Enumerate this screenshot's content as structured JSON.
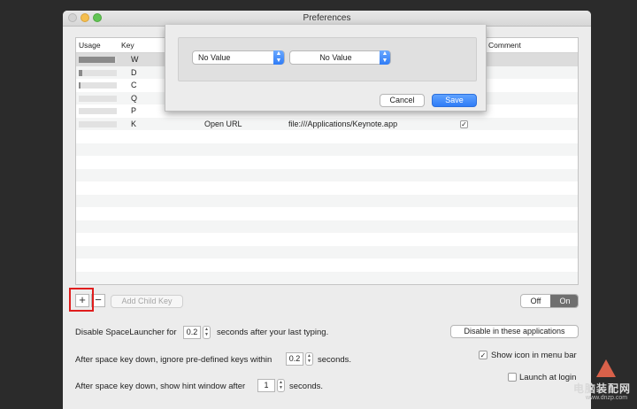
{
  "window": {
    "title": "Preferences"
  },
  "table": {
    "columns": {
      "usage": "Usage",
      "key": "Key",
      "comment": "Comment"
    },
    "rows": [
      {
        "key": "W",
        "usage": 0.95,
        "action": "",
        "target": "",
        "enabled": false
      },
      {
        "key": "D",
        "usage": 0.1,
        "action": "",
        "target": "",
        "enabled": false
      },
      {
        "key": "C",
        "usage": 0.05,
        "action": "",
        "target": "",
        "enabled": false
      },
      {
        "key": "Q",
        "usage": 0.0,
        "action": "",
        "target": "",
        "enabled": false
      },
      {
        "key": "P",
        "usage": 0.0,
        "action": "",
        "target": "",
        "enabled": false
      },
      {
        "key": "K",
        "usage": 0.0,
        "action": "Open URL",
        "target": "file:///Applications/Keynote.app",
        "enabled": true
      }
    ]
  },
  "sheet": {
    "popup1": "No Value",
    "popup2": "No Value",
    "cancel": "Cancel",
    "save": "Save"
  },
  "toolbar": {
    "plus": "+",
    "minus": "−",
    "add_child": "Add Child Key",
    "off": "Off",
    "on": "On"
  },
  "settings": {
    "disable_prefix": "Disable SpaceLauncher for",
    "disable_value": "0.2",
    "disable_suffix": "seconds after your last typing.",
    "disable_apps": "Disable in these applications",
    "ignore_prefix": "After space key down, ignore pre-defined keys within",
    "ignore_value": "0.2",
    "ignore_suffix": "seconds.",
    "show_icon": "Show icon in menu bar",
    "show_icon_checked": true,
    "hint_prefix": "After space key down, show hint window after",
    "hint_value": "1",
    "hint_suffix": "seconds.",
    "launch_login": "Launch at login",
    "launch_login_checked": false
  },
  "watermark": {
    "text": "电脑装配网",
    "sub": "www.dnzp.com"
  },
  "colors": {
    "accent": "#2f7cf6",
    "highlight": "#e01d1d"
  }
}
